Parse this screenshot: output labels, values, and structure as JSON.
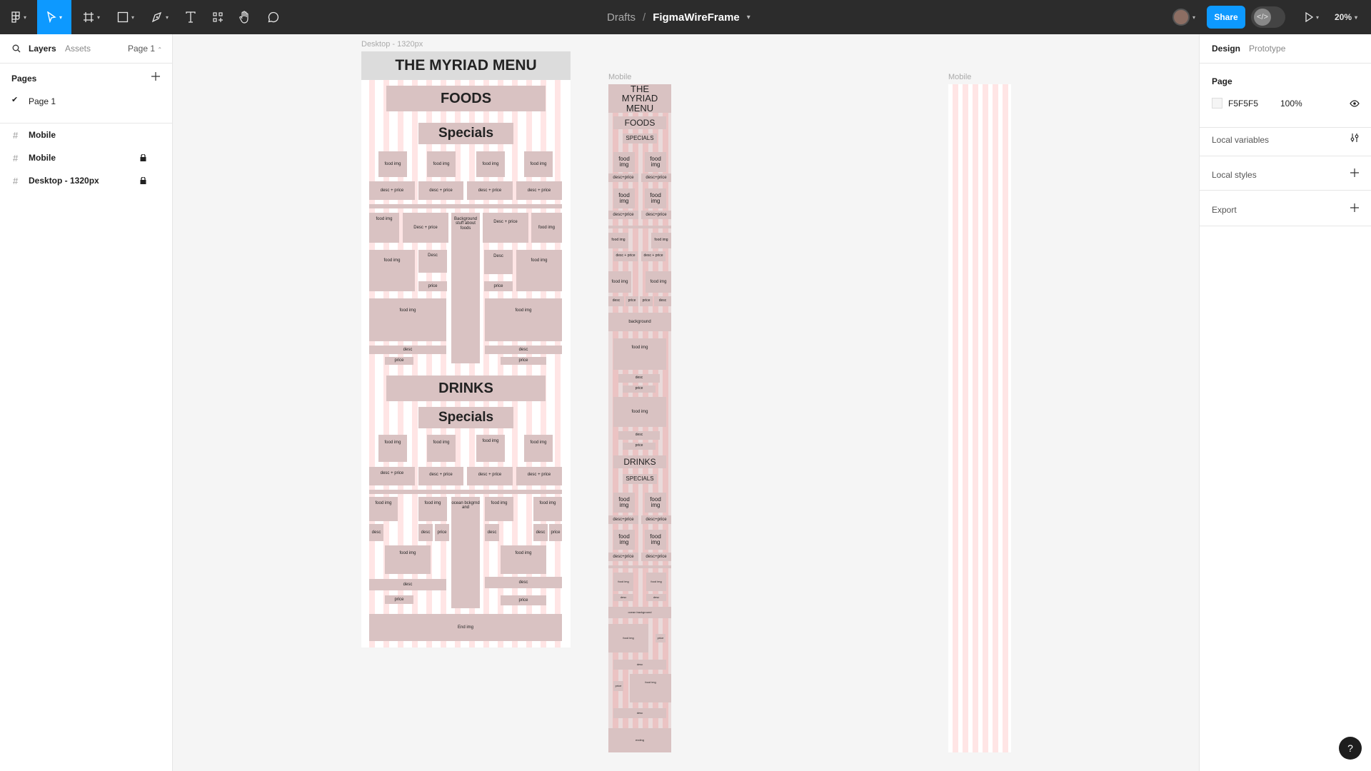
{
  "toolbar": {
    "breadcrumb_root": "Drafts",
    "file_name": "FigmaWireFrame",
    "share_label": "Share",
    "zoom": "20%",
    "accent": "#0d99ff"
  },
  "left_panel": {
    "tabs": [
      "Layers",
      "Assets"
    ],
    "page_selector": "Page 1",
    "pages_heading": "Pages",
    "pages": [
      "Page 1"
    ],
    "layers": [
      {
        "name": "Mobile",
        "locked": false
      },
      {
        "name": "Mobile",
        "locked": true
      },
      {
        "name": "Desktop - 1320px",
        "locked": true
      }
    ]
  },
  "right_panel": {
    "tabs": [
      "Design",
      "Prototype"
    ],
    "page_heading": "Page",
    "bg_hex": "F5F5F5",
    "bg_opacity": "100%",
    "sections": [
      "Local variables",
      "Local styles",
      "Export"
    ]
  },
  "canvas": {
    "desktop": {
      "label": "Desktop - 1320px",
      "title": "THE MYRIAD MENU",
      "foods": "FOODS",
      "specials": "Specials",
      "drinks": "DRINKS",
      "specials2": "Specials",
      "food_img": "food img",
      "desc_price": "desc + price",
      "desc_price_alt": "Desc + price",
      "desc": "desc",
      "desc_cap": "Desc",
      "price": "price",
      "background_note": "Background stuff about foods",
      "ocean_note": "ocean bckgrnd and",
      "end_img": "End img"
    },
    "mobile1": {
      "label": "Mobile",
      "title": "THE MYRIAD MENU",
      "foods": "FOODS",
      "specials": "SPECIALS",
      "drinks": "DRINKS",
      "specials2": "SPECIALS",
      "food_img": "food img",
      "desc_price": "desc+price",
      "desc_price_sp": "desc + price",
      "desc": "desc",
      "price": "price",
      "background": "background",
      "ocean_background": "ocean background",
      "ending": "ending"
    },
    "mobile2": {
      "label": "Mobile"
    }
  },
  "help_label": "?"
}
